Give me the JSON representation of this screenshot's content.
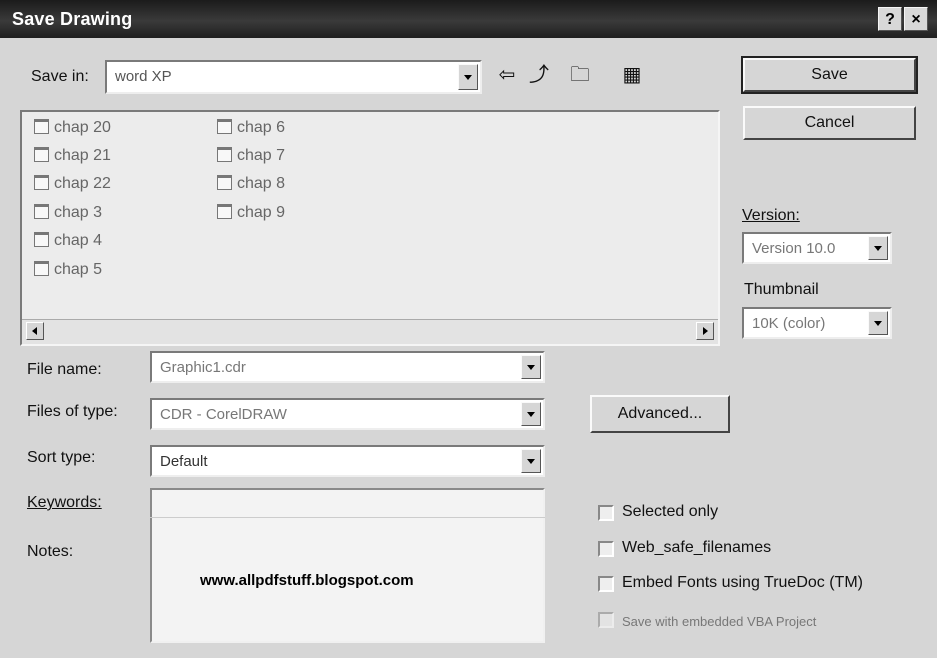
{
  "window": {
    "title": "Save Drawing",
    "help_button": "?",
    "close_button": "×"
  },
  "save_in": {
    "label": "Save in:",
    "value": "word XP"
  },
  "toolbar": {
    "back_icon": "⇦",
    "up_icon": "⤴",
    "new_folder_icon": "🗀",
    "views_icon": "▦"
  },
  "files": [
    {
      "name": "chap 20"
    },
    {
      "name": "chap 21"
    },
    {
      "name": "chap 22"
    },
    {
      "name": "chap 3"
    },
    {
      "name": "chap 4"
    },
    {
      "name": "chap 5"
    },
    {
      "name": "chap 6"
    },
    {
      "name": "chap 7"
    },
    {
      "name": "chap 8"
    },
    {
      "name": "chap 9"
    }
  ],
  "buttons": {
    "save": "Save",
    "cancel": "Cancel",
    "advanced": "Advanced..."
  },
  "version": {
    "label": "Version:",
    "value": "Version 10.0"
  },
  "thumbnail": {
    "label": "Thumbnail",
    "value": "10K (color)"
  },
  "fields": {
    "file_name_label": "File name:",
    "file_name_value": "Graphic1.cdr",
    "files_of_type_label": "Files of type:",
    "files_of_type_value": "CDR - CorelDRAW",
    "sort_type_label": "Sort type:",
    "sort_type_value": "Default",
    "keywords_label": "Keywords:",
    "notes_label": "Notes:"
  },
  "options": {
    "selected_only": "Selected only",
    "web_safe_filenames": "Web_safe_filenames",
    "embed_fonts": "Embed Fonts using TrueDoc (TM)",
    "faint_option": "Save with embedded VBA Project"
  },
  "watermark_text": "www.allpdfstuff.blogspot.com"
}
